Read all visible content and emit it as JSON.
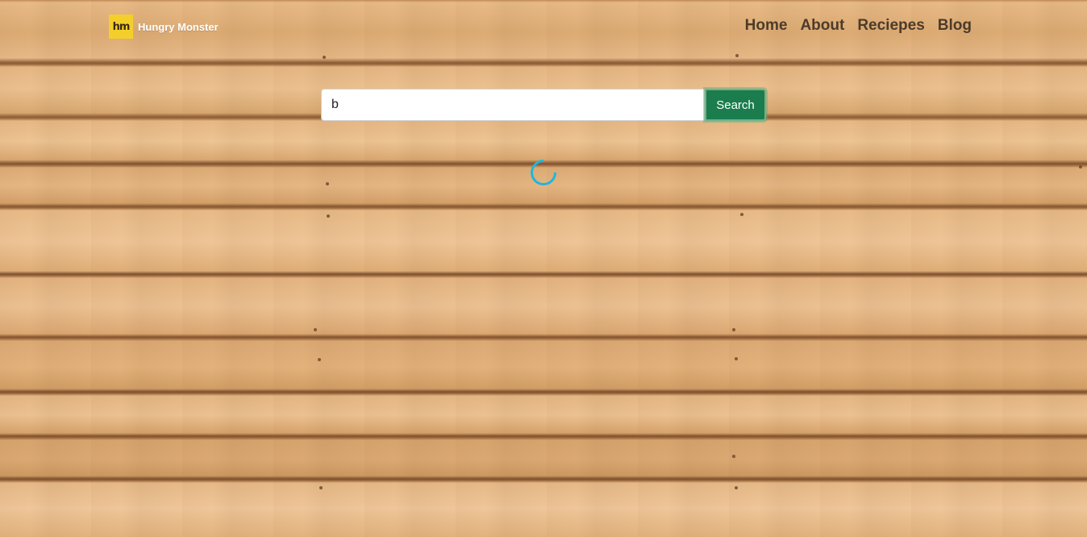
{
  "brand": {
    "logo_text": "hm",
    "name": "Hungry Monster"
  },
  "nav": {
    "items": [
      {
        "label": "Home"
      },
      {
        "label": "About"
      },
      {
        "label": "Reciepes"
      },
      {
        "label": "Blog"
      }
    ]
  },
  "search": {
    "value": "b",
    "button_label": "Search"
  },
  "loading": {
    "spinner_color": "#21b6d8"
  },
  "colors": {
    "brand_logo_bg": "#f4cf2c",
    "search_button_bg": "#1b7c4d",
    "nav_link": "#4d3b29"
  }
}
